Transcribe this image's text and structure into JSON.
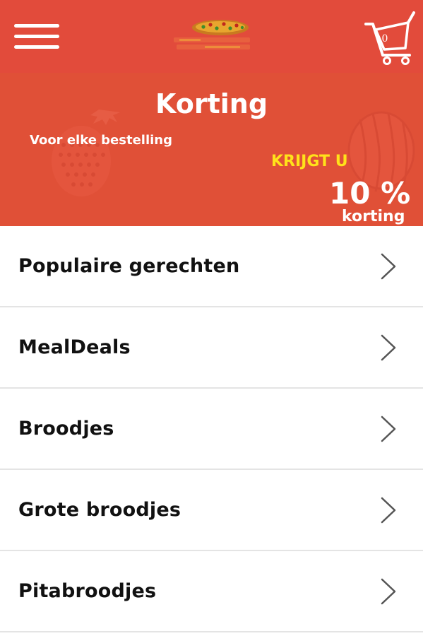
{
  "header": {
    "menu_icon": "hamburger-menu-icon",
    "logo_icon": "pizza-logo-icon",
    "cart_icon": "shopping-cart-icon",
    "cart_count": "0",
    "background_color": "#e24b3b"
  },
  "banner": {
    "title": "Korting",
    "subtitle": "Voor elke bestelling",
    "krijgt_label": "KRIJGT U",
    "discount_value": "10 %",
    "discount_label": "korting",
    "background_color": "#e05037",
    "highlight_color": "#ffe21a",
    "decorations": [
      "strawberry-icon",
      "watermelon-icon"
    ]
  },
  "menu": {
    "items": [
      {
        "label": "Populaire gerechten",
        "icon": "chevron-right-icon"
      },
      {
        "label": "MealDeals",
        "icon": "chevron-right-icon"
      },
      {
        "label": "Broodjes",
        "icon": "chevron-right-icon"
      },
      {
        "label": "Grote broodjes",
        "icon": "chevron-right-icon"
      },
      {
        "label": "Pitabroodjes",
        "icon": "chevron-right-icon"
      }
    ]
  }
}
